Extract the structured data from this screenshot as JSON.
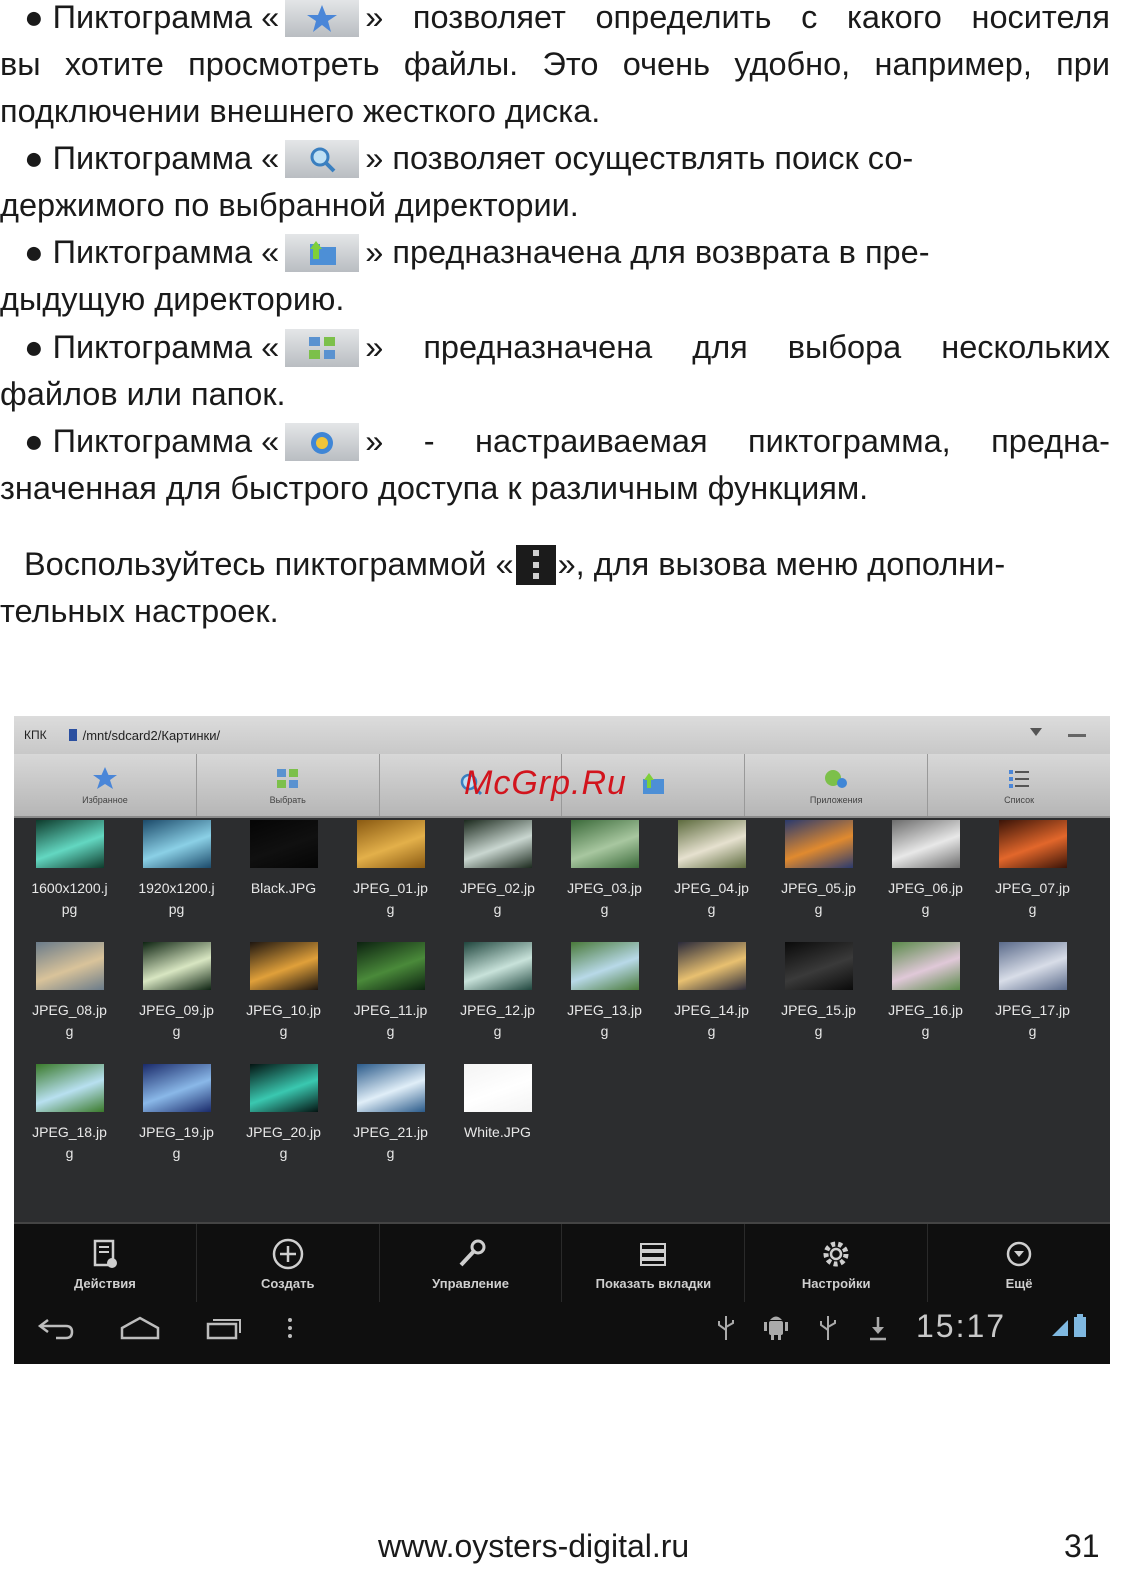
{
  "bullets": [
    {
      "line1_before": "● Пиктограмма «",
      "icon": "star-icon",
      "line1_after": "» позволяет определить с какого носителя",
      "line2": "вы хотите просмотреть файлы. Это очень удобно, например, при",
      "line3": "подключении внешнего жесткого диска."
    },
    {
      "line1_before": "● Пиктограмма «",
      "icon": "search-icon",
      "line1_after": "» позволяет осуществлять поиск со-",
      "line2": "держимого по выбранной директории."
    },
    {
      "line1_before": "● Пиктограмма «",
      "icon": "folder-up-icon",
      "line1_after": "» предназначена для возврата в пре-",
      "line2": "дыдущую директорию."
    },
    {
      "line1_before": "● Пиктограмма «",
      "icon": "multi-select-icon",
      "line1_after": "» предназначена для выбора нескольких",
      "line2": "файлов или папок."
    },
    {
      "line1_before": "● Пиктограмма «",
      "icon": "custom-shortcut-icon",
      "line1_after": "» - настраиваемая пиктограмма, предна-",
      "line2": "значенная для быстрого доступа к различным функциям."
    }
  ],
  "menu_note": {
    "before": "Воспользуйтесь пиктограммой «",
    "icon": "kebab-menu-icon",
    "after": "», для вызова меню дополни-",
    "line2": "тельных настроек."
  },
  "screenshot": {
    "root_label": "КПК",
    "path": "/mnt/sdcard2/Картинки/",
    "toolbar": [
      {
        "label": "Избранное",
        "icon": "star-icon"
      },
      {
        "label": "Выбрать",
        "icon": "multi-select-icon"
      },
      {
        "label": "",
        "icon": "search-icon"
      },
      {
        "label": "",
        "icon": "folder-up-icon"
      },
      {
        "label": "Приложения",
        "icon": "custom-shortcut-icon"
      },
      {
        "label": "Список",
        "icon": "list-view-icon"
      }
    ],
    "files": [
      {
        "name": "1600x1200.j\npg",
        "colors": [
          "#0e3b2c",
          "#63d7c1"
        ]
      },
      {
        "name": "1920x1200.j\npg",
        "colors": [
          "#1c4a6a",
          "#8bd0e6"
        ]
      },
      {
        "name": "Black.JPG",
        "colors": [
          "#050505",
          "#101010"
        ]
      },
      {
        "name": "JPEG_01.jp\ng",
        "colors": [
          "#8a5a12",
          "#e3b04a"
        ]
      },
      {
        "name": "JPEG_02.jp\ng",
        "colors": [
          "#1c2a1e",
          "#c9d6d0"
        ]
      },
      {
        "name": "JPEG_03.jp\ng",
        "colors": [
          "#3b6a3a",
          "#a8c7a0"
        ]
      },
      {
        "name": "JPEG_04.jp\ng",
        "colors": [
          "#5d6b3e",
          "#e6e1cf"
        ]
      },
      {
        "name": "JPEG_05.jp\ng",
        "colors": [
          "#2a3a6e",
          "#e08a2f"
        ]
      },
      {
        "name": "JPEG_06.jp\ng",
        "colors": [
          "#6c6c6c",
          "#e8e8e8"
        ]
      },
      {
        "name": "JPEG_07.jp\ng",
        "colors": [
          "#3a1408",
          "#e2672b"
        ]
      },
      {
        "name": "JPEG_08.jp\ng",
        "colors": [
          "#6a7b8a",
          "#d9c39a"
        ]
      },
      {
        "name": "JPEG_09.jp\ng",
        "colors": [
          "#0e2412",
          "#d8e6c2"
        ]
      },
      {
        "name": "JPEG_10.jp\ng",
        "colors": [
          "#1e1610",
          "#e0a03a"
        ]
      },
      {
        "name": "JPEG_11.jp\ng",
        "colors": [
          "#0c2210",
          "#4a8a3a"
        ]
      },
      {
        "name": "JPEG_12.jp\ng",
        "colors": [
          "#20463e",
          "#c8e2da"
        ]
      },
      {
        "name": "JPEG_13.jp\ng",
        "colors": [
          "#4a7a3a",
          "#b8d9e8"
        ]
      },
      {
        "name": "JPEG_14.jp\ng",
        "colors": [
          "#2a2a3a",
          "#e8c070"
        ]
      },
      {
        "name": "JPEG_15.jp\ng",
        "colors": [
          "#0a0a0a",
          "#3a3a3a"
        ]
      },
      {
        "name": "JPEG_16.jp\ng",
        "colors": [
          "#5a8a4a",
          "#e0c8d8"
        ]
      },
      {
        "name": "JPEG_17.jp\ng",
        "colors": [
          "#5a6a8a",
          "#d8dde8"
        ]
      },
      {
        "name": "JPEG_18.jp\ng",
        "colors": [
          "#3a7a2a",
          "#b8e0f0"
        ]
      },
      {
        "name": "JPEG_19.jp\ng",
        "colors": [
          "#1a2a6a",
          "#8ab8e8"
        ]
      },
      {
        "name": "JPEG_20.jp\ng",
        "colors": [
          "#041412",
          "#3ac8b0"
        ]
      },
      {
        "name": "JPEG_21.jp\ng",
        "colors": [
          "#2a5a8a",
          "#e0eef8"
        ]
      },
      {
        "name": "White.JPG",
        "colors": [
          "#f4f4f4",
          "#ffffff"
        ]
      }
    ],
    "actions": [
      {
        "label": "Действия",
        "icon": "actions-icon"
      },
      {
        "label": "Создать",
        "icon": "add-circle-icon"
      },
      {
        "label": "Управление",
        "icon": "wrench-icon"
      },
      {
        "label": "Показать вкладки",
        "icon": "tabs-icon"
      },
      {
        "label": "Настройки",
        "icon": "gear-icon"
      },
      {
        "label": "Ещё",
        "icon": "chevron-down-circle-icon"
      }
    ],
    "clock": "15:17"
  },
  "watermark": "McGrp.Ru",
  "footer": {
    "url": "www.oysters-digital.ru",
    "page": "31"
  }
}
